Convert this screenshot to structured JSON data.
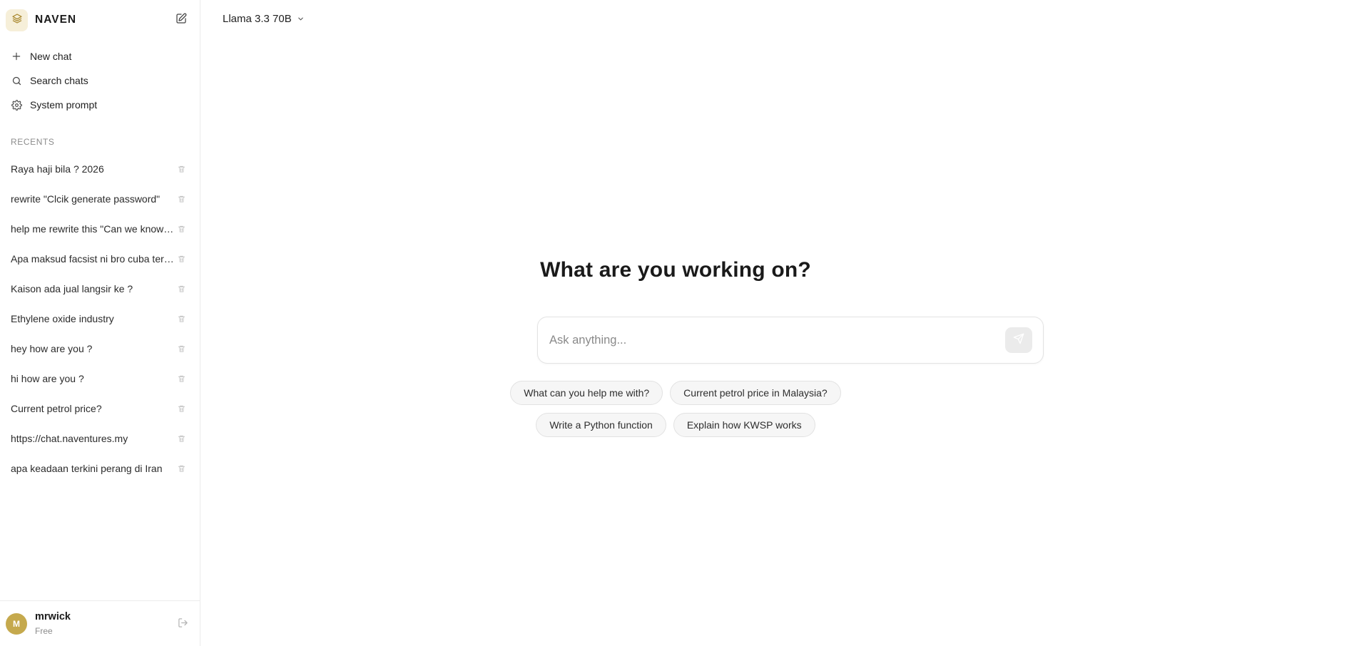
{
  "brand": {
    "name": "NAVEN"
  },
  "nav": [
    {
      "label": "New chat",
      "icon": "plus-icon"
    },
    {
      "label": "Search chats",
      "icon": "search-icon"
    },
    {
      "label": "System prompt",
      "icon": "gear-icon"
    }
  ],
  "recents": {
    "label": "RECENTS",
    "items": [
      "Raya haji bila ? 2026",
      "rewrite \"Clcik generate password\"",
      "help me rewrite this \"Can we know the",
      "Apa maksud facsist ni bro cuba terangkan",
      "Kaison ada jual langsir ke ?",
      "Ethylene oxide industry",
      "hey how are you ?",
      "hi how are you ?",
      "Current petrol price?",
      "https://chat.naventures.my",
      "apa keadaan terkini perang di Iran"
    ]
  },
  "user": {
    "initial": "M",
    "name": "mrwick",
    "plan": "Free"
  },
  "model": {
    "name": "Llama 3.3 70B"
  },
  "main": {
    "headline": "What are you working on?",
    "input_placeholder": "Ask anything...",
    "suggestions_row1": [
      "What can you help me with?",
      "Current petrol price in Malaysia?"
    ],
    "suggestions_row2": [
      "Write a Python function",
      "Explain how KWSP works"
    ]
  },
  "colors": {
    "accent_avatar": "#c5a94d",
    "logo_bg": "#f6efd9",
    "border": "#ececec",
    "muted_text": "#8c8c8c"
  }
}
